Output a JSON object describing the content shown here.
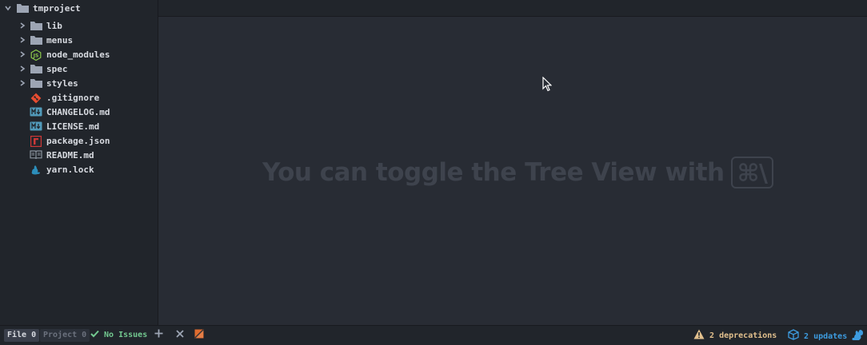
{
  "tree": {
    "root": "tmproject",
    "items": [
      {
        "label": "lib",
        "icon": "folder-icon",
        "type": "dir"
      },
      {
        "label": "menus",
        "icon": "folder-icon",
        "type": "dir"
      },
      {
        "label": "node_modules",
        "icon": "nodejs-folder-icon",
        "type": "dir"
      },
      {
        "label": "spec",
        "icon": "folder-icon",
        "type": "dir"
      },
      {
        "label": "styles",
        "icon": "folder-icon",
        "type": "dir"
      },
      {
        "label": ".gitignore",
        "icon": "git-icon",
        "type": "file"
      },
      {
        "label": "CHANGELOG.md",
        "icon": "markdown-icon",
        "type": "file"
      },
      {
        "label": "LICENSE.md",
        "icon": "markdown-icon",
        "type": "file"
      },
      {
        "label": "package.json",
        "icon": "npm-icon",
        "type": "file"
      },
      {
        "label": "README.md",
        "icon": "book-icon",
        "type": "file"
      },
      {
        "label": "yarn.lock",
        "icon": "yarn-icon",
        "type": "file"
      }
    ]
  },
  "editor": {
    "hint_text": "You can toggle the Tree View with",
    "hint_key": "⌘\\"
  },
  "status": {
    "file_tab": "File 0",
    "project_tab": "Project 0",
    "no_issues": "No Issues",
    "deprecations": "2 deprecations",
    "updates": "2 updates"
  },
  "colors": {
    "accent_green": "#73c990",
    "warning": "#e2c08d",
    "info": "#3d9ce0",
    "git_red": "#e84d31"
  }
}
